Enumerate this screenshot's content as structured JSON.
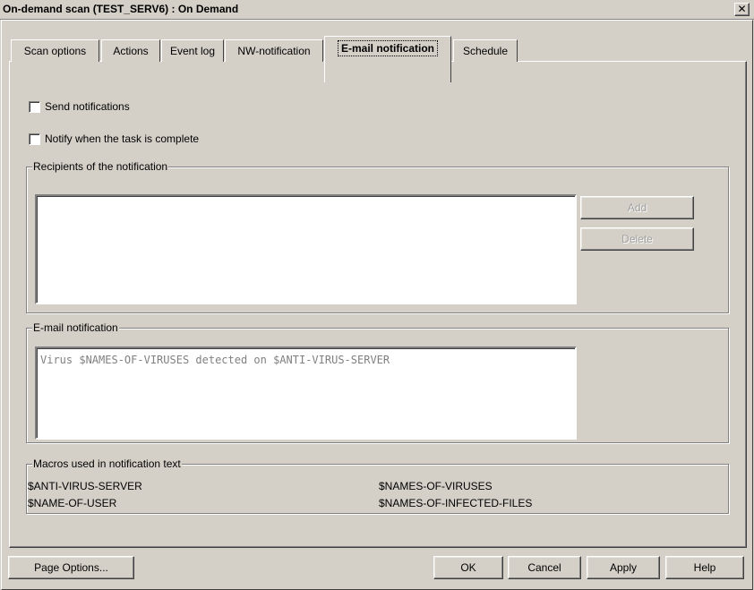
{
  "window": {
    "title": "On-demand scan (TEST_SERV6) : On Demand",
    "close_glyph": "✕"
  },
  "tabs": [
    {
      "label": "Scan options"
    },
    {
      "label": "Actions"
    },
    {
      "label": "Event log"
    },
    {
      "label": "NW-notification"
    },
    {
      "label": "E-mail notification",
      "active": true
    },
    {
      "label": "Schedule"
    }
  ],
  "options": {
    "send_notifications": {
      "label": "Send notifications",
      "checked": false
    },
    "notify_complete": {
      "label": "Notify when the task is complete",
      "checked": false
    }
  },
  "recipients": {
    "legend": "Recipients of the notification",
    "add_label": "Add",
    "delete_label": "Delete"
  },
  "email": {
    "legend": "E-mail notification",
    "text": "Virus $NAMES-OF-VIRUSES detected on $ANTI-VIRUS-SERVER"
  },
  "macros": {
    "legend": "Macros used in notification text",
    "items": [
      "$ANTI-VIRUS-SERVER",
      "$NAMES-OF-VIRUSES",
      "$NAME-OF-USER",
      "$NAMES-OF-INFECTED-FILES"
    ]
  },
  "footer": {
    "page_options_label": "Page Options...",
    "ok_label": "OK",
    "cancel_label": "Cancel",
    "apply_label": "Apply",
    "help_label": "Help"
  }
}
